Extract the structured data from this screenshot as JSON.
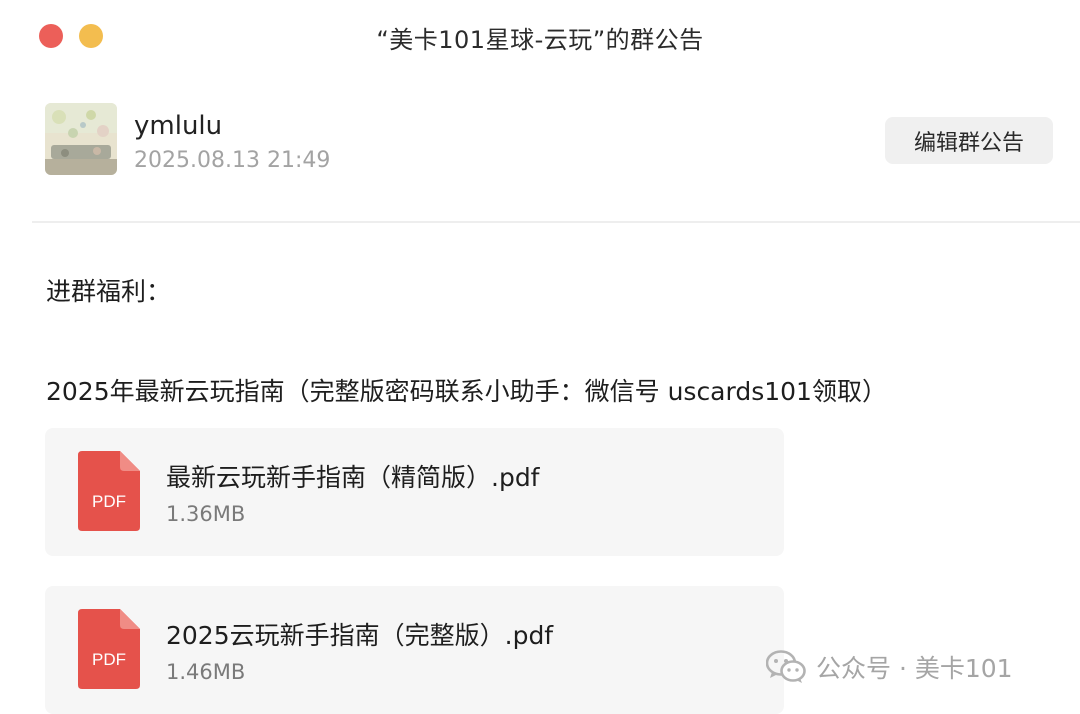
{
  "window": {
    "title": "“美卡101星球-云玩”的群公告"
  },
  "author": {
    "name": "ymlulu",
    "time": "2025.08.13 21:49"
  },
  "actions": {
    "edit_label": "编辑群公告"
  },
  "announcement": {
    "benefit_heading": "进群福利：",
    "guide_intro": "2025年最新云玩指南（完整版密码联系小助手：微信号 uscards101领取）"
  },
  "files": [
    {
      "name": "最新云玩新手指南（精简版）.pdf",
      "size": "1.36MB",
      "icon": "pdf-icon",
      "icon_label": "PDF"
    },
    {
      "name": "2025云玩新手指南（完整版）.pdf",
      "size": "1.46MB",
      "icon": "pdf-icon",
      "icon_label": "PDF"
    }
  ],
  "watermark": {
    "icon": "wechat-icon",
    "text": "公众号 · 美卡101"
  },
  "colors": {
    "close": "#ec5f59",
    "minimize": "#f3bd4f",
    "pdf_red": "#e5524b",
    "card_bg": "#f6f6f6",
    "button_bg": "#f0f0f0"
  }
}
